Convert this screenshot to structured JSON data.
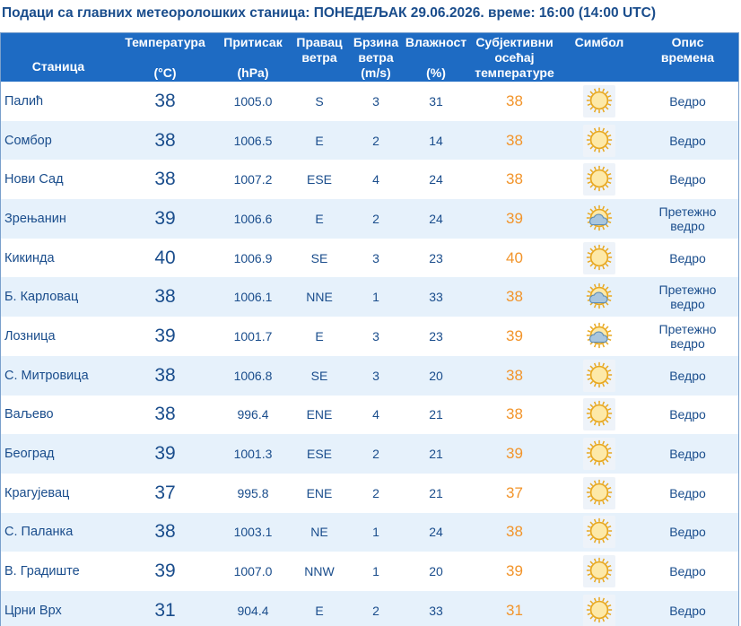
{
  "title": "Подаци са главних метеоролошких станица:  ПОНЕДЕЉАК 29.06.2026.  време: 16:00 (14:00 UTC)",
  "headers": {
    "station": "Станица",
    "temp_l1": "Температура",
    "temp_l2": "(°C)",
    "pressure_l1": "Притисак",
    "pressure_l2": "(hPa)",
    "wind_dir_l1": "Правац",
    "wind_dir_l2": "ветра",
    "wind_speed_l1": "Брзина",
    "wind_speed_l2": "ветра",
    "wind_speed_l3": "(m/s)",
    "humidity_l1": "Влажност",
    "humidity_l2": "(%)",
    "feels_l1": "Субјективни",
    "feels_l2": "осећај",
    "feels_l3": "температуре",
    "symbol": "Симбол",
    "desc_l1": "Опис",
    "desc_l2": "времена"
  },
  "colors": {
    "header_bg": "#1e6bc3",
    "text": "#1a4d8c",
    "feels": "#f2942a",
    "alt_row": "#e6f1fb"
  },
  "rows": [
    {
      "station": "Палић",
      "temp": "38",
      "pressure": "1005.0",
      "wind_dir": "S",
      "wind_speed": "3",
      "humidity": "31",
      "feels": "38",
      "icon": "sun-icon",
      "desc_l1": "Ведро",
      "desc_l2": ""
    },
    {
      "station": "Сомбор",
      "temp": "38",
      "pressure": "1006.5",
      "wind_dir": "E",
      "wind_speed": "2",
      "humidity": "14",
      "feels": "38",
      "icon": "sun-icon",
      "desc_l1": "Ведро",
      "desc_l2": ""
    },
    {
      "station": "Нови Сад",
      "temp": "38",
      "pressure": "1007.2",
      "wind_dir": "ESE",
      "wind_speed": "4",
      "humidity": "24",
      "feels": "38",
      "icon": "sun-icon",
      "desc_l1": "Ведро",
      "desc_l2": ""
    },
    {
      "station": "Зрењанин",
      "temp": "39",
      "pressure": "1006.6",
      "wind_dir": "E",
      "wind_speed": "2",
      "humidity": "24",
      "feels": "39",
      "icon": "sun-cloud-icon",
      "desc_l1": "Претежно",
      "desc_l2": "ведро"
    },
    {
      "station": "Кикинда",
      "temp": "40",
      "pressure": "1006.9",
      "wind_dir": "SE",
      "wind_speed": "3",
      "humidity": "23",
      "feels": "40",
      "icon": "sun-icon",
      "desc_l1": "Ведро",
      "desc_l2": ""
    },
    {
      "station": "Б. Карловац",
      "temp": "38",
      "pressure": "1006.1",
      "wind_dir": "NNE",
      "wind_speed": "1",
      "humidity": "33",
      "feels": "38",
      "icon": "sun-cloud-icon",
      "desc_l1": "Претежно",
      "desc_l2": "ведро"
    },
    {
      "station": "Лозница",
      "temp": "39",
      "pressure": "1001.7",
      "wind_dir": "E",
      "wind_speed": "3",
      "humidity": "23",
      "feels": "39",
      "icon": "sun-cloud-icon",
      "desc_l1": "Претежно",
      "desc_l2": "ведро"
    },
    {
      "station": "С. Митровица",
      "temp": "38",
      "pressure": "1006.8",
      "wind_dir": "SE",
      "wind_speed": "3",
      "humidity": "20",
      "feels": "38",
      "icon": "sun-icon",
      "desc_l1": "Ведро",
      "desc_l2": ""
    },
    {
      "station": "Ваљево",
      "temp": "38",
      "pressure": "996.4",
      "wind_dir": "ENE",
      "wind_speed": "4",
      "humidity": "21",
      "feels": "38",
      "icon": "sun-icon",
      "desc_l1": "Ведро",
      "desc_l2": ""
    },
    {
      "station": "Београд",
      "temp": "39",
      "pressure": "1001.3",
      "wind_dir": "ESE",
      "wind_speed": "2",
      "humidity": "21",
      "feels": "39",
      "icon": "sun-icon",
      "desc_l1": "Ведро",
      "desc_l2": ""
    },
    {
      "station": "Крагујевац",
      "temp": "37",
      "pressure": "995.8",
      "wind_dir": "ENE",
      "wind_speed": "2",
      "humidity": "21",
      "feels": "37",
      "icon": "sun-icon",
      "desc_l1": "Ведро",
      "desc_l2": ""
    },
    {
      "station": "С. Паланка",
      "temp": "38",
      "pressure": "1003.1",
      "wind_dir": "NE",
      "wind_speed": "1",
      "humidity": "24",
      "feels": "38",
      "icon": "sun-icon",
      "desc_l1": "Ведро",
      "desc_l2": ""
    },
    {
      "station": "В. Градиште",
      "temp": "39",
      "pressure": "1007.0",
      "wind_dir": "NNW",
      "wind_speed": "1",
      "humidity": "20",
      "feels": "39",
      "icon": "sun-icon",
      "desc_l1": "Ведро",
      "desc_l2": ""
    },
    {
      "station": "Црни Врх",
      "temp": "31",
      "pressure": "904.4",
      "wind_dir": "E",
      "wind_speed": "2",
      "humidity": "33",
      "feels": "31",
      "icon": "sun-icon",
      "desc_l1": "Ведро",
      "desc_l2": ""
    }
  ]
}
